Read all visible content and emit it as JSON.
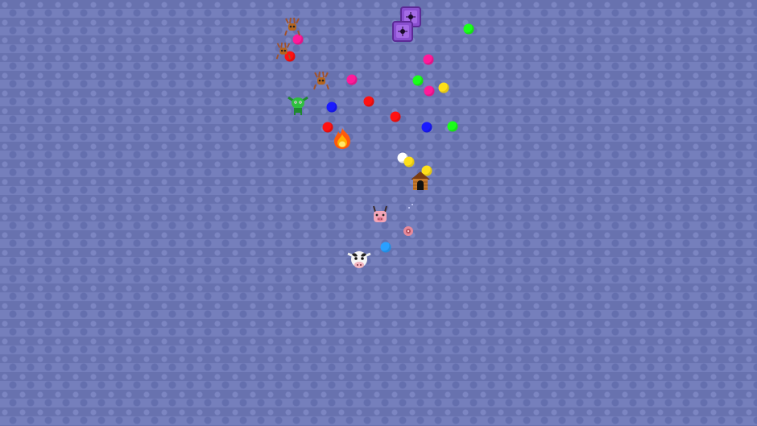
{
  "scene": {
    "background_color": "#6e78b8",
    "orbs": [
      {
        "color": "#ff1a9a",
        "kind": "magenta"
      },
      {
        "color": "#ff1111",
        "kind": "red"
      },
      {
        "color": "#ff1a9a",
        "kind": "magenta"
      },
      {
        "color": "#ff1111",
        "kind": "red"
      },
      {
        "color": "#1a1aff",
        "kind": "blue"
      },
      {
        "color": "#ff1111",
        "kind": "red"
      },
      {
        "color": "#ff1111",
        "kind": "red"
      },
      {
        "color": "#ff1111",
        "kind": "red"
      },
      {
        "color": "#1aff1a",
        "kind": "green"
      },
      {
        "color": "#ff1a9a",
        "kind": "magenta"
      },
      {
        "color": "#1aff1a",
        "kind": "green"
      },
      {
        "color": "#ff1a9a",
        "kind": "magenta"
      },
      {
        "color": "#ffe01a",
        "kind": "yellow"
      },
      {
        "color": "#1a1aff",
        "kind": "blue"
      },
      {
        "color": "#1aff1a",
        "kind": "green"
      },
      {
        "color": "#ffffff",
        "kind": "white"
      },
      {
        "color": "#ffe01a",
        "kind": "yellow"
      },
      {
        "color": "#ffe01a",
        "kind": "yellow"
      },
      {
        "color": "#2aa0ff",
        "kind": "light-blue"
      }
    ],
    "sprites": [
      {
        "name": "reindeer-icon"
      },
      {
        "name": "reindeer-icon"
      },
      {
        "name": "reindeer-icon"
      },
      {
        "name": "purple-stone-block-icon"
      },
      {
        "name": "purple-stone-block-icon"
      },
      {
        "name": "green-goblin-icon"
      },
      {
        "name": "fire-icon"
      },
      {
        "name": "doghouse-icon"
      },
      {
        "name": "horned-pig-icon"
      },
      {
        "name": "small-pink-creature-icon"
      },
      {
        "name": "cow-player-icon"
      }
    ]
  }
}
